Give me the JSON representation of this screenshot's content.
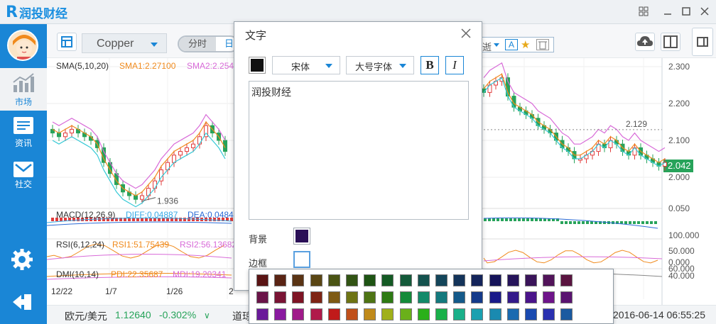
{
  "app": {
    "logo_text": "润投财经"
  },
  "nav": [
    {
      "label": "市场",
      "icon": "chart-icon",
      "active": true
    },
    {
      "label": "资讯",
      "icon": "news-icon",
      "active": false
    },
    {
      "label": "社交",
      "icon": "mail-icon",
      "active": false
    }
  ],
  "toolbar": {
    "symbol": "Copper",
    "period_options": [
      "分时",
      "日"
    ],
    "right_partial": "逝"
  },
  "indicators": {
    "sma": {
      "name": "SMA(5,10,20)",
      "sma1": "SMA1:2.27100",
      "sma2": "SMA2:2.254"
    },
    "macd": {
      "name": "MACD(12,26,9)",
      "diff": "DIFF:0.04887",
      "dea": "DEA:0.0484"
    },
    "rsi": {
      "name": "RSI(6,12,24)",
      "rsi1": "RSI1:51.75439",
      "rsi2": "RSI2:56.13682"
    },
    "dmi": {
      "name": "DMI(10,14)",
      "pdi": "PDI:22.35687",
      "mdi": "MDI:19.20341"
    }
  },
  "chart_data": {
    "type": "candlestick",
    "price_axis_ticks": [
      "2.300",
      "2.200",
      "2.100",
      "2.000"
    ],
    "current_price": "2.042",
    "annotations": {
      "high": "2.129",
      "low": "1.936"
    },
    "macd_axis_ticks": [
      "0.050"
    ],
    "rsi_axis_ticks": [
      "100.000",
      "50.000",
      "0.000"
    ],
    "dmi_axis_ticks": [
      "60.000",
      "40.000"
    ],
    "date_ticks": [
      "12/22",
      "1/7",
      "1/26",
      "2"
    ],
    "colors": {
      "up": "#e03c3c",
      "down": "#27a35a",
      "sma1": "#f08a1c",
      "sma2": "#d86ad8",
      "sma3": "#35c9d6"
    }
  },
  "ticker": {
    "pair": "欧元/美元",
    "price": "1.12640",
    "change": "-0.302%",
    "next_label": "道琼",
    "datetime": "2016-06-14 06:55:25"
  },
  "dialog": {
    "title": "文字",
    "font": "宋体",
    "size": "大号字体",
    "bold": "B",
    "italic": "I",
    "text": "润投财经",
    "bg_label": "背景",
    "border_label": "边框",
    "text_color": "#111111",
    "bg_color": "#2a0f57",
    "border_color": "#ffffff"
  },
  "palette": [
    [
      "#5a1414",
      "#5a2414",
      "#5a3414",
      "#5a4614",
      "#4a5414",
      "#325414",
      "#1e5414",
      "#145a24",
      "#145a3a",
      "#14524e",
      "#14465a",
      "#14345a",
      "#14245a",
      "#16145a",
      "#26145a",
      "#3a145a",
      "#52145a",
      "#5a1440"
    ],
    [
      "#6a1448",
      "#7a1434",
      "#7e1424",
      "#7e2414",
      "#7e5a14",
      "#6e7414",
      "#4e7414",
      "#2e7a14",
      "#148a3a",
      "#148a6a",
      "#147a7e",
      "#145a8a",
      "#143a8a",
      "#1a1a8a",
      "#341a8a",
      "#4a148a",
      "#6e148a",
      "#5a1470"
    ],
    [
      "#6a1a9a",
      "#8a1aa0",
      "#a01a8a",
      "#b01a4a",
      "#c01a1a",
      "#c0501a",
      "#c08a1a",
      "#a0b01a",
      "#6ab01a",
      "#2ab01a",
      "#1ab04a",
      "#1ab08a",
      "#1aa0b0",
      "#1a8ab0",
      "#1a6ab0",
      "#1a4ab0",
      "#2a30b0",
      "#1a5aa0"
    ]
  ]
}
